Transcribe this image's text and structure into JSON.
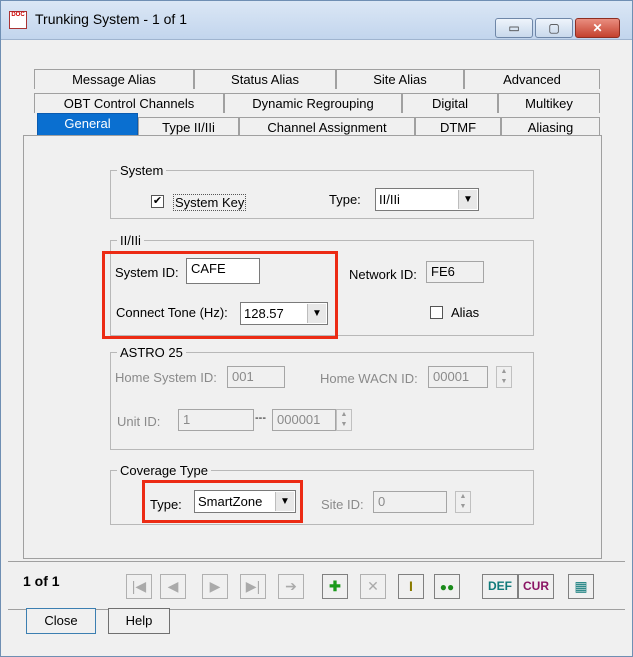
{
  "window": {
    "title": "Trunking System - 1 of 1",
    "icon_text": "DOC",
    "minimize": "▭",
    "maximize": "▢",
    "close": "✕"
  },
  "tabs": {
    "row1": [
      "Message Alias",
      "Status Alias",
      "Site Alias",
      "Advanced"
    ],
    "row2": [
      "OBT Control Channels",
      "Dynamic Regrouping",
      "Digital",
      "Multikey"
    ],
    "row3": [
      "General",
      "Type II/IIi",
      "Channel Assignment",
      "DTMF",
      "Aliasing"
    ]
  },
  "system": {
    "legend": "System",
    "system_key_label": "System Key",
    "system_key_checked": true,
    "type_label": "Type:",
    "type_value": "II/IIi"
  },
  "ii_iii": {
    "legend": "II/IIi",
    "system_id_label": "System ID:",
    "system_id_value": "CAFE",
    "network_id_label": "Network ID:",
    "network_id_value": "FE6",
    "connect_tone_label": "Connect Tone (Hz):",
    "connect_tone_value": "128.57",
    "alias_label": "Alias"
  },
  "astro25": {
    "legend": "ASTRO 25",
    "home_system_id_label": "Home System ID:",
    "home_system_id_value": "001",
    "home_wacn_id_label": "Home WACN ID:",
    "home_wacn_id_value": "00001",
    "unit_id_label": "Unit ID:",
    "unit_id_start": "1",
    "unit_id_dash": "---",
    "unit_id_end": "000001"
  },
  "coverage": {
    "legend": "Coverage Type",
    "type_label": "Type:",
    "type_value": "SmartZone",
    "site_id_label": "Site ID:",
    "site_id_value": "0"
  },
  "record": {
    "counter": "1 of 1"
  },
  "toolbar": {
    "def_label": "DEF",
    "cur_label": "CUR"
  },
  "buttons": {
    "close": "Close",
    "help": "Help"
  },
  "colors": {
    "selected_tab": "#0a6fd0",
    "highlight": "#ec2b14",
    "def": "#0f7a7a",
    "cur": "#8a1464"
  }
}
